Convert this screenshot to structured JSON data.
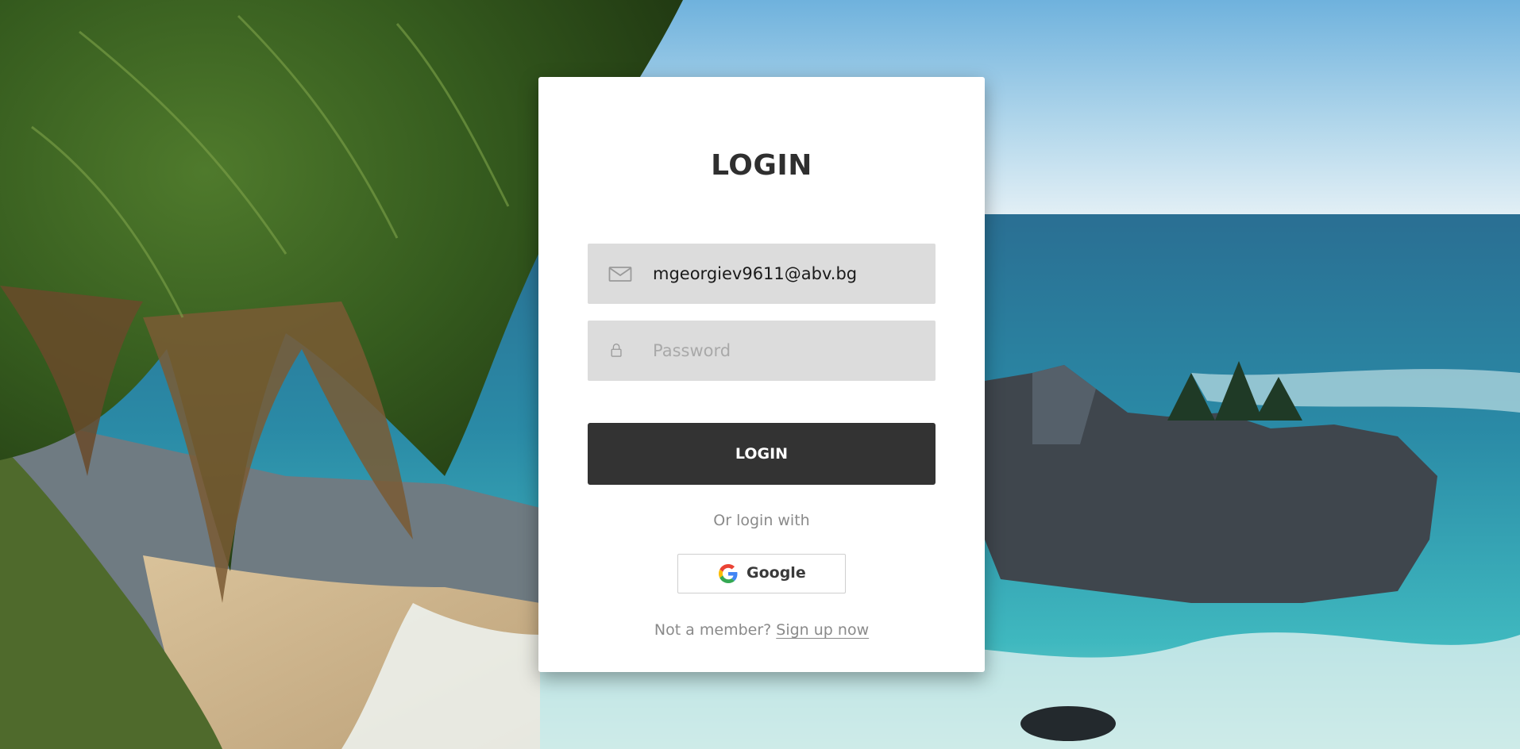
{
  "login": {
    "title": "LOGIN",
    "email": {
      "value": "mgeorgiev9611@abv.bg",
      "icon": "envelope-icon"
    },
    "password": {
      "placeholder": "Password",
      "value": "",
      "icon": "lock-icon"
    },
    "submit_label": "LOGIN",
    "or_text": "Or login with",
    "google_label": "Google",
    "google_icon": "google-icon",
    "not_member_text": "Not a member?",
    "signup_label": "Sign up now"
  },
  "colors": {
    "button_dark": "#333333",
    "field_bg": "#dcdcdc",
    "muted_text": "#8a8a8a"
  }
}
